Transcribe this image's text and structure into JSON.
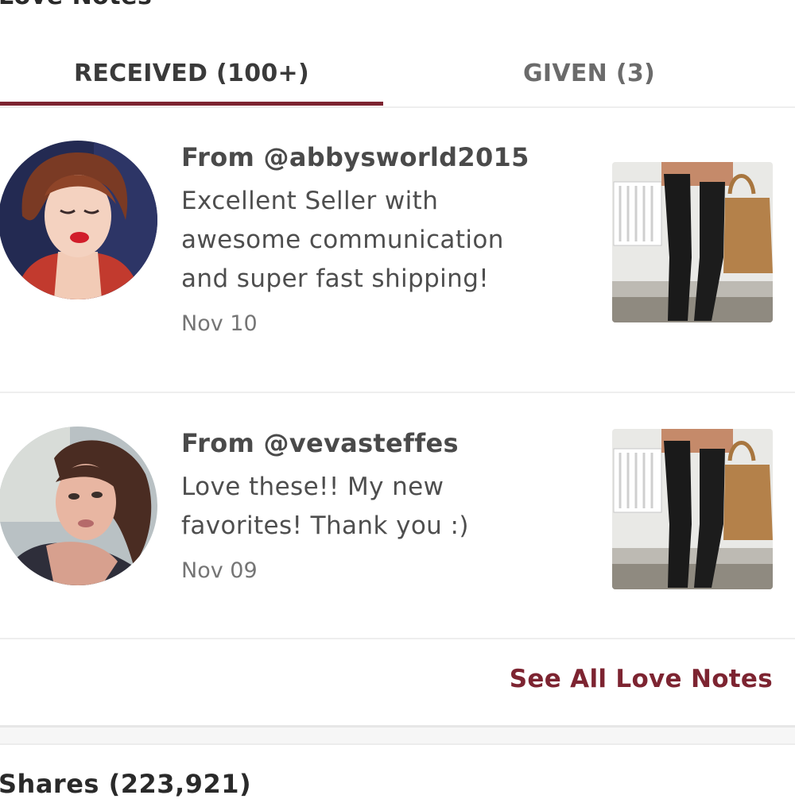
{
  "section": {
    "title": "Love Notes"
  },
  "tabs": [
    {
      "label": "RECEIVED (100+)",
      "active": true
    },
    {
      "label": "GIVEN (3)",
      "active": false
    }
  ],
  "notes": [
    {
      "from": "From @abbysworld2015",
      "message": "Excellent Seller with\nawesome communication\nand super fast shipping!",
      "date": "Nov 10",
      "avatar_icon": "avatar-illustrated-woman",
      "thumb_icon": "product-thumbnail-boots"
    },
    {
      "from": "From @vevasteffes",
      "message": "Love these!! My new\nfavorites! Thank you :)",
      "date": "Nov 09",
      "avatar_icon": "avatar-photo-woman",
      "thumb_icon": "product-thumbnail-boots"
    }
  ],
  "see_all": {
    "label": "See All Love Notes"
  },
  "shares": {
    "title": "Shares (223,921)"
  },
  "colors": {
    "accent": "#7d2431",
    "divider": "#eeeeee",
    "text": "#4a4a4a"
  }
}
